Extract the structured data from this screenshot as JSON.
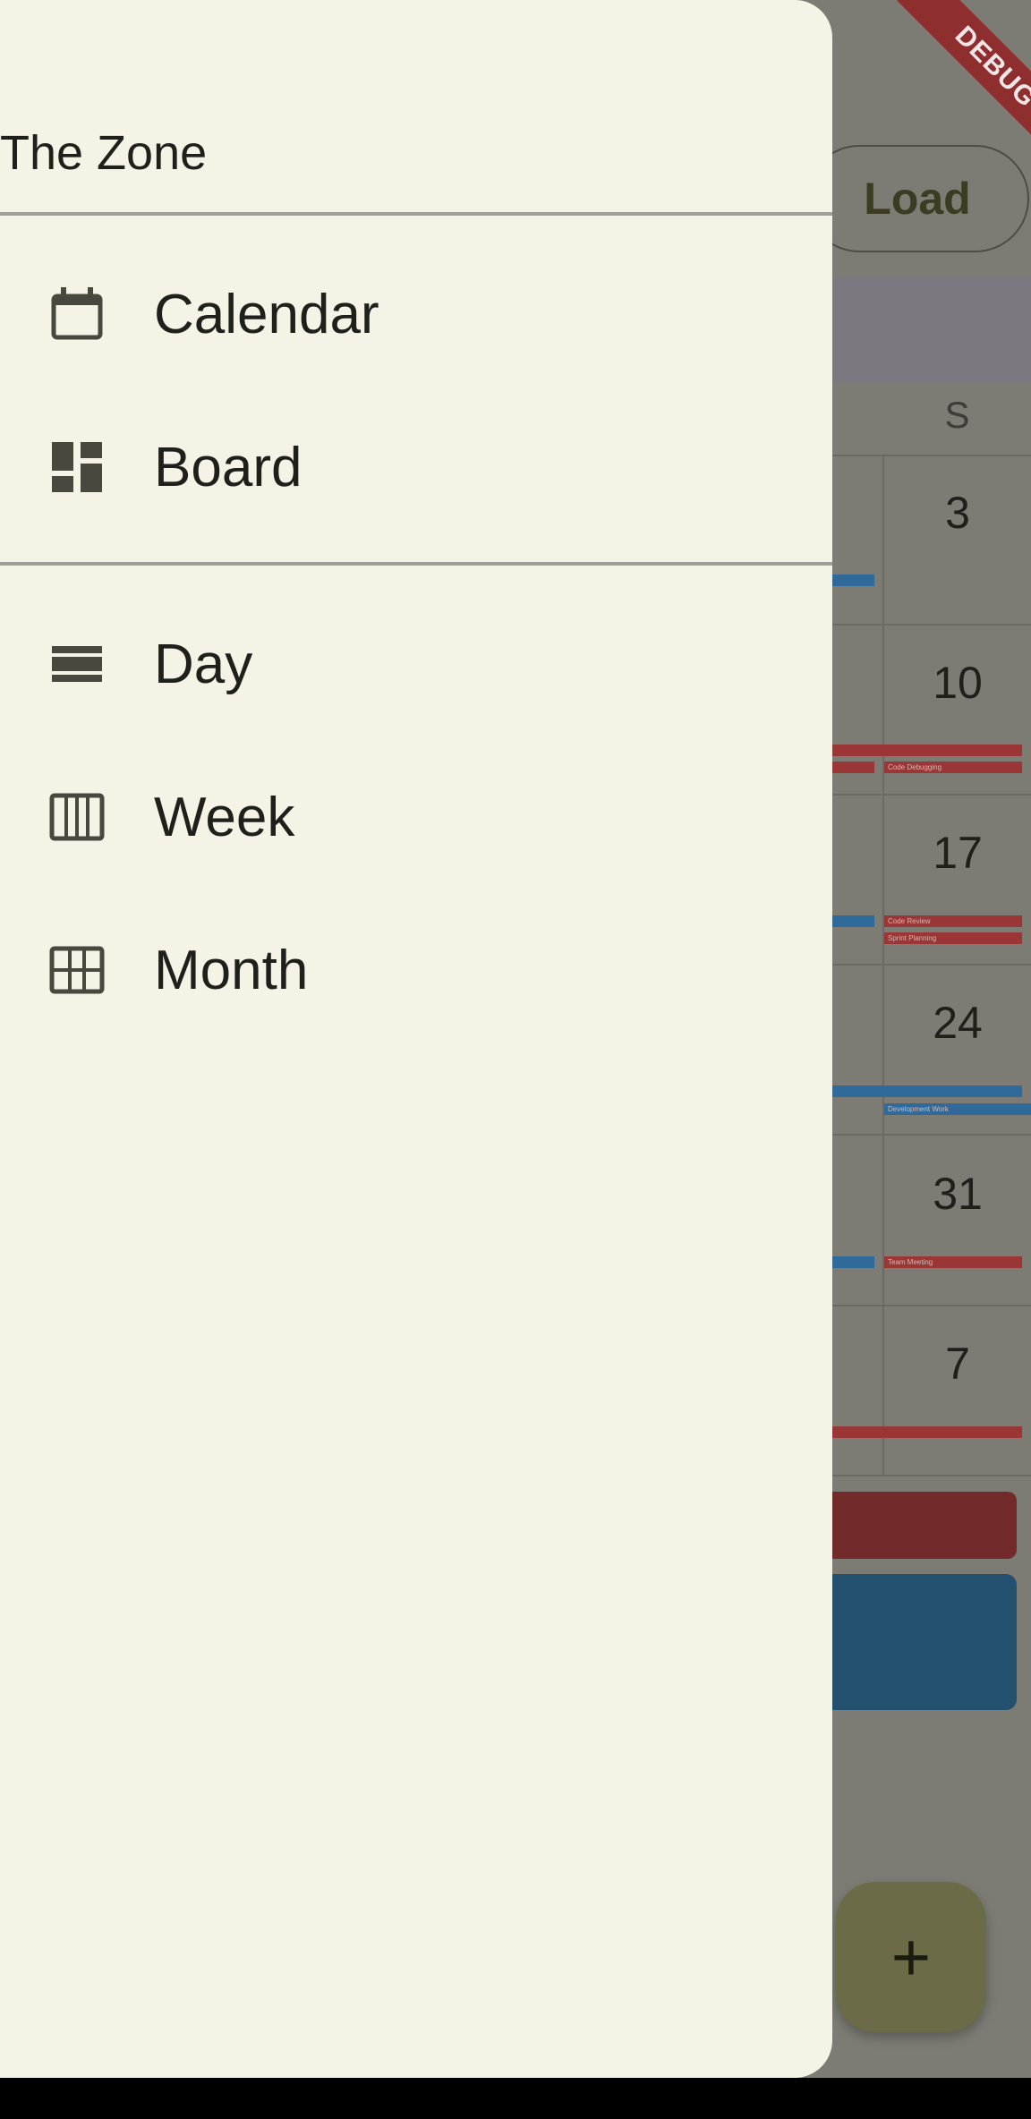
{
  "drawer": {
    "title": "The Zone",
    "sections": [
      [
        {
          "label": "Calendar",
          "icon": "calendar-icon"
        },
        {
          "label": "Board",
          "icon": "dashboard-icon"
        }
      ],
      [
        {
          "label": "Day",
          "icon": "day-view-icon"
        },
        {
          "label": "Week",
          "icon": "week-view-icon"
        },
        {
          "label": "Month",
          "icon": "month-view-icon"
        }
      ]
    ]
  },
  "background": {
    "load_label": "Load",
    "weekday": "S",
    "days": [
      "3",
      "10",
      "17",
      "24",
      "31",
      "7"
    ],
    "events": [
      "Code Debugging",
      "Code Review",
      "Sprint Planning",
      "Development Work",
      "Team Meeting"
    ],
    "fab_label": "+"
  },
  "debug_banner": "DEBUG",
  "colors": {
    "drawer_bg": "#f5f2e6",
    "scrim": "#7c7b74",
    "event_red": "#9a3636",
    "event_blue": "#2f6a9a",
    "fab": "#6b6c47",
    "debug": "#8e2e2e"
  }
}
